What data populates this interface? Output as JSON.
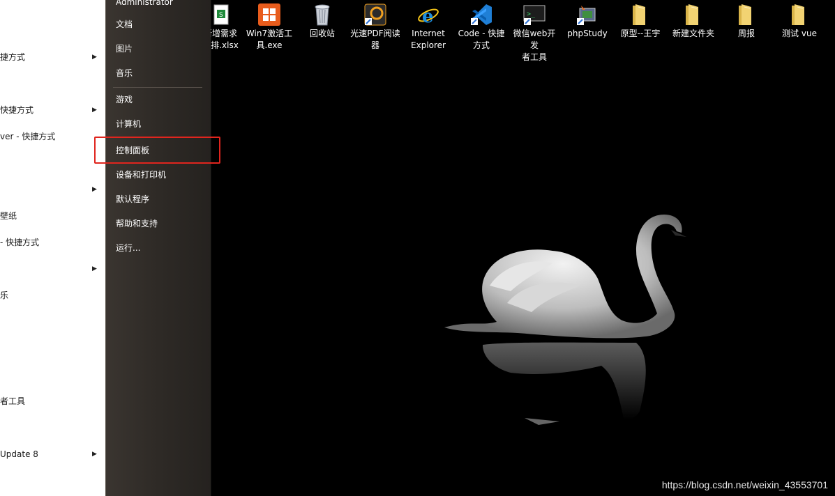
{
  "left_list": {
    "items": [
      {
        "label": "捷方式",
        "arrow": true
      },
      {
        "label": "快捷方式",
        "arrow": true
      },
      {
        "label": "ver - 快捷方式",
        "arrow": false
      },
      {
        "label": "",
        "arrow": true
      },
      {
        "label": "壁纸",
        "arrow": false
      },
      {
        "label": "- 快捷方式",
        "arrow": false
      },
      {
        "label": "",
        "arrow": true
      },
      {
        "label": "乐",
        "arrow": false
      },
      {
        "label": "者工具",
        "arrow": false
      },
      {
        "label": "Update 8",
        "arrow": true
      }
    ]
  },
  "start_menu_right": {
    "user": "Administrator",
    "items": [
      "文档",
      "图片",
      "音乐",
      "游戏",
      "计算机",
      "控制面板",
      "设备和打印机",
      "默认程序",
      "帮助和支持",
      "运行..."
    ]
  },
  "desktop": {
    "icons": [
      {
        "label": "新增需求\n安排.xlsx",
        "icon": "excel-file-icon"
      },
      {
        "label": "Win7激活工\n具.exe",
        "icon": "windows-logo-icon"
      },
      {
        "label": "回收站",
        "icon": "recycle-bin-icon"
      },
      {
        "label": "光速PDF阅读\n器",
        "icon": "pdf-reader-icon"
      },
      {
        "label": "Internet\nExplorer",
        "icon": "internet-explorer-icon"
      },
      {
        "label": "Code - 快捷\n方式",
        "icon": "vscode-icon"
      },
      {
        "label": "微信web开发\n者工具",
        "icon": "wechat-devtools-icon"
      },
      {
        "label": "phpStudy",
        "icon": "phpstudy-icon"
      },
      {
        "label": "原型--王宇",
        "icon": "folder-icon"
      },
      {
        "label": "新建文件夹",
        "icon": "folder-icon"
      },
      {
        "label": "周报",
        "icon": "folder-icon"
      },
      {
        "label": "测试 vue",
        "icon": "folder-icon"
      }
    ]
  },
  "watermark": "https://blog.csdn.net/weixin_43553701",
  "colors": {
    "highlight": "#e0251e",
    "menu_bg": "#2e2a26",
    "desktop_bg": "#000000"
  }
}
